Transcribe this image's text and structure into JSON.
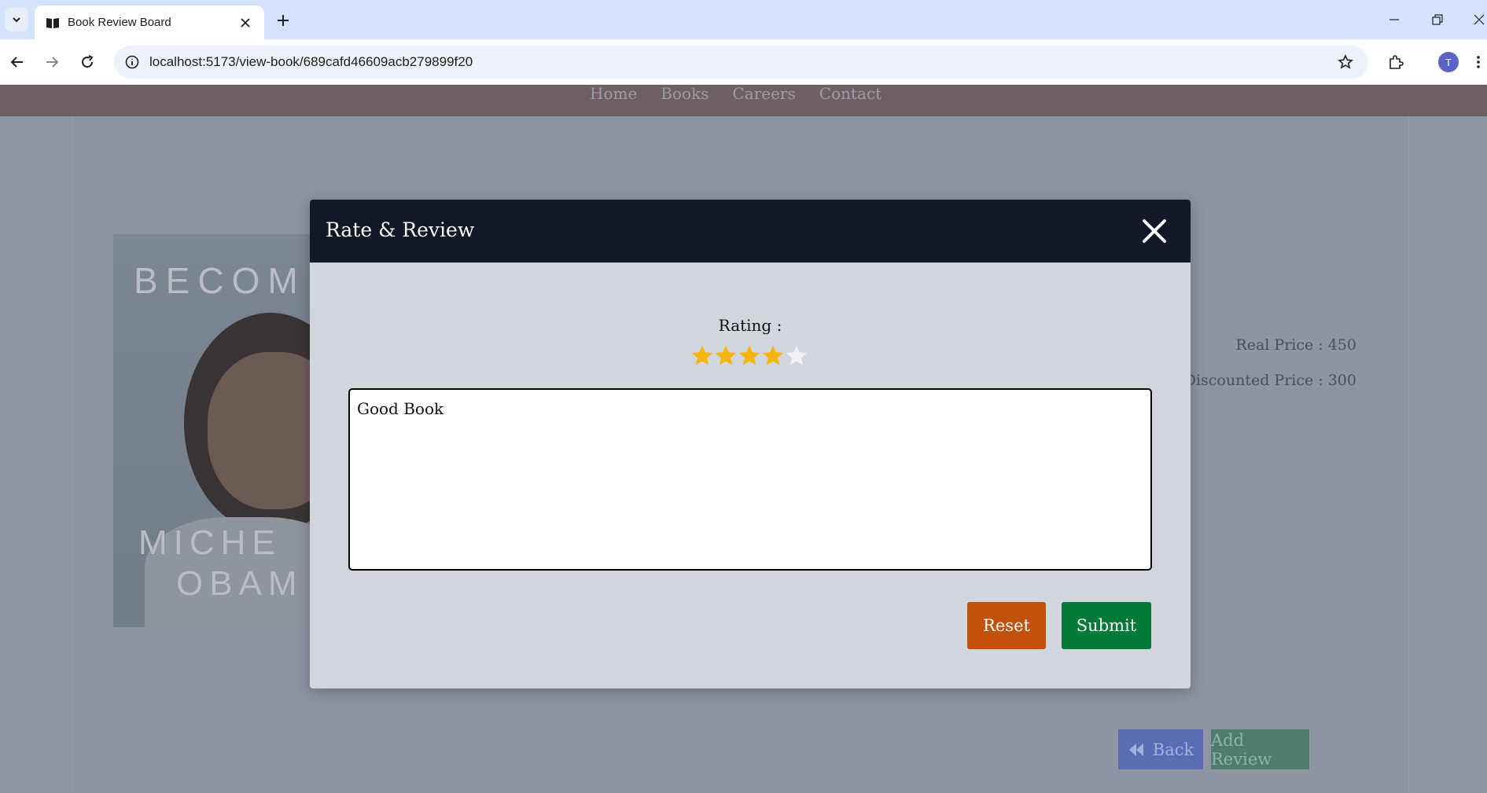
{
  "browser": {
    "tab_title": "Book Review Board",
    "url": "localhost:5173/view-book/689cafd46609acb279899f20",
    "profile_initial": "T"
  },
  "nav": {
    "links": [
      "Home",
      "Books",
      "Careers",
      "Contact"
    ]
  },
  "book": {
    "cover_top_text": "BECOM",
    "cover_name_line1": "MICHE",
    "cover_name_line2": "OBAM",
    "real_price_label": "Real Price : 450",
    "discounted_price_label": "Discounted Price : 300"
  },
  "actions": {
    "back_label": "Back",
    "add_review_label": "Add Review"
  },
  "modal": {
    "title": "Rate & Review",
    "rating_label": "Rating :",
    "rating_value": 4,
    "rating_max": 5,
    "review_text": "Good Book",
    "reset_label": "Reset",
    "submit_label": "Submit"
  },
  "colors": {
    "star_filled": "#f5b50a",
    "star_empty": "#f1f1f1",
    "reset_bg": "#c2510c",
    "submit_bg": "#047a37",
    "modal_header_bg": "#111827"
  }
}
